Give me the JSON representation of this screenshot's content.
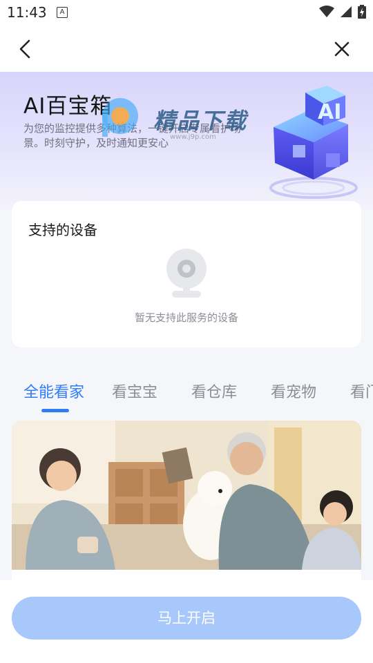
{
  "status_bar": {
    "time": "11:43",
    "indicator": "A"
  },
  "header": {
    "back_icon": "chevron-left-icon",
    "close_icon": "close-icon"
  },
  "hero": {
    "title": "AI百宝箱",
    "description": "为您的监控提供多种算法，一键开启专属看护场景。时刻守护，及时通知更安心",
    "badge_text": "AI"
  },
  "watermark": {
    "text": "精品下载",
    "url": "www.j9p.com"
  },
  "devices": {
    "title": "支持的设备",
    "empty_text": "暂无支持此服务的设备"
  },
  "tabs": [
    {
      "label": "全能看家",
      "active": true
    },
    {
      "label": "看宝宝",
      "active": false
    },
    {
      "label": "看仓库",
      "active": false
    },
    {
      "label": "看宠物",
      "active": false
    },
    {
      "label": "看门",
      "active": false
    }
  ],
  "cta": {
    "label": "马上开启"
  },
  "colors": {
    "accent": "#2f7cf6",
    "cta_bg": "#a8c8fb",
    "hero_top": "#d7d4fb"
  }
}
